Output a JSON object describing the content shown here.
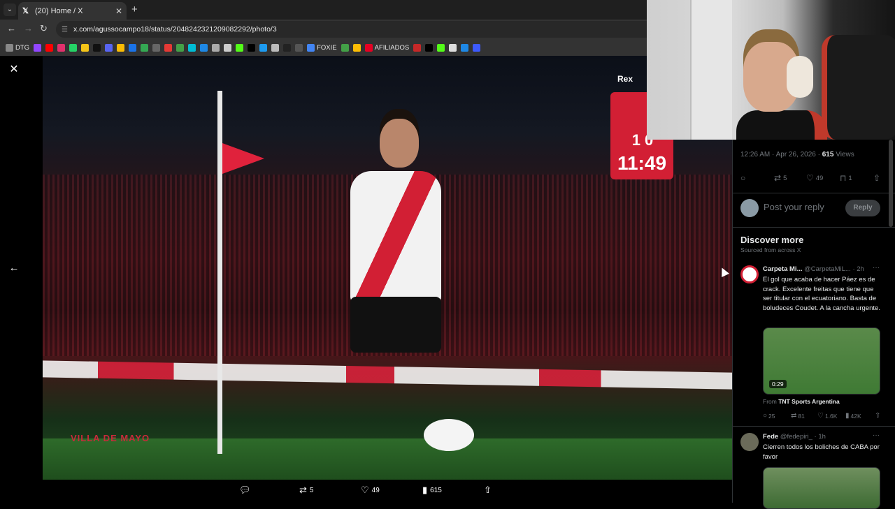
{
  "browser": {
    "tab_title": "(20) Home / X",
    "url": "x.com/agussocampo18/status/2048242321209082292/photo/3",
    "bookmarks": [
      {
        "label": "DTG",
        "color": "#888"
      },
      {
        "label": "",
        "color": "#9146ff"
      },
      {
        "label": "",
        "color": "#ff0000"
      },
      {
        "label": "",
        "color": "#e1306c"
      },
      {
        "label": "",
        "color": "#25d366"
      },
      {
        "label": "",
        "color": "#f5c518"
      },
      {
        "label": "",
        "color": "#111"
      },
      {
        "label": "",
        "color": "#5865f2"
      },
      {
        "label": "",
        "color": "#fbbc04"
      },
      {
        "label": "",
        "color": "#1a73e8"
      },
      {
        "label": "",
        "color": "#34a853"
      },
      {
        "label": "",
        "color": "#666"
      },
      {
        "label": "",
        "color": "#e53935"
      },
      {
        "label": "",
        "color": "#43a047"
      },
      {
        "label": "",
        "color": "#00bcd4"
      },
      {
        "label": "",
        "color": "#1e88e5"
      },
      {
        "label": "",
        "color": "#aaa"
      },
      {
        "label": "",
        "color": "#ccc"
      },
      {
        "label": "",
        "color": "#53fc18"
      },
      {
        "label": "",
        "color": "#000"
      },
      {
        "label": "",
        "color": "#1d9bf0"
      },
      {
        "label": "",
        "color": "#bbb"
      },
      {
        "label": "",
        "color": "#222"
      },
      {
        "label": "",
        "color": "#555"
      },
      {
        "label": "FOXIE",
        "color": "#4285f4"
      },
      {
        "label": "",
        "color": "#43a047"
      },
      {
        "label": "",
        "color": "#fbbc04"
      },
      {
        "label": "AFILIADOS",
        "color": "#e60023"
      },
      {
        "label": "",
        "color": "#c62828"
      },
      {
        "label": "",
        "color": "#000"
      },
      {
        "label": "",
        "color": "#53fc18"
      },
      {
        "label": "",
        "color": "#ddd"
      },
      {
        "label": "",
        "color": "#1e88e5"
      },
      {
        "label": "",
        "color": "#3d5afe"
      }
    ]
  },
  "viewer": {
    "scoreboard_brand": "Rex",
    "score": "1  0",
    "clock": "11:49",
    "banner": "VILLA DE MAYO",
    "actions": {
      "retweets": "5",
      "likes": "49",
      "views": "615"
    }
  },
  "post": {
    "time": "12:26 AM · Apr 26, 2026 · ",
    "views_count": "615",
    "views_label": " Views",
    "retweets": "5",
    "likes": "49",
    "bookmarks": "1",
    "reply_placeholder": "Post your reply",
    "reply_button": "Reply"
  },
  "discover": {
    "title": "Discover more",
    "subtitle": "Sourced from across X",
    "posts": [
      {
        "name": "Carpeta Mi...",
        "handle": " @CarpetaMiL... · 2h",
        "text": "El gol que acaba de hacer Páez es de crack. Excelente freitas que tiene que ser titular con el ecuatoriano. Basta de boludeces Coudet. A la cancha urgente.",
        "duration": "0:29",
        "from_prefix": "From ",
        "from_source": "TNT Sports Argentina",
        "replies": "25",
        "retweets": "81",
        "likes": "1.6K",
        "views": "42K"
      },
      {
        "name": "Fede",
        "handle": " @fedepiri_ · 1h",
        "text": "Cierren todos los boliches de CABA por favor"
      }
    ]
  }
}
